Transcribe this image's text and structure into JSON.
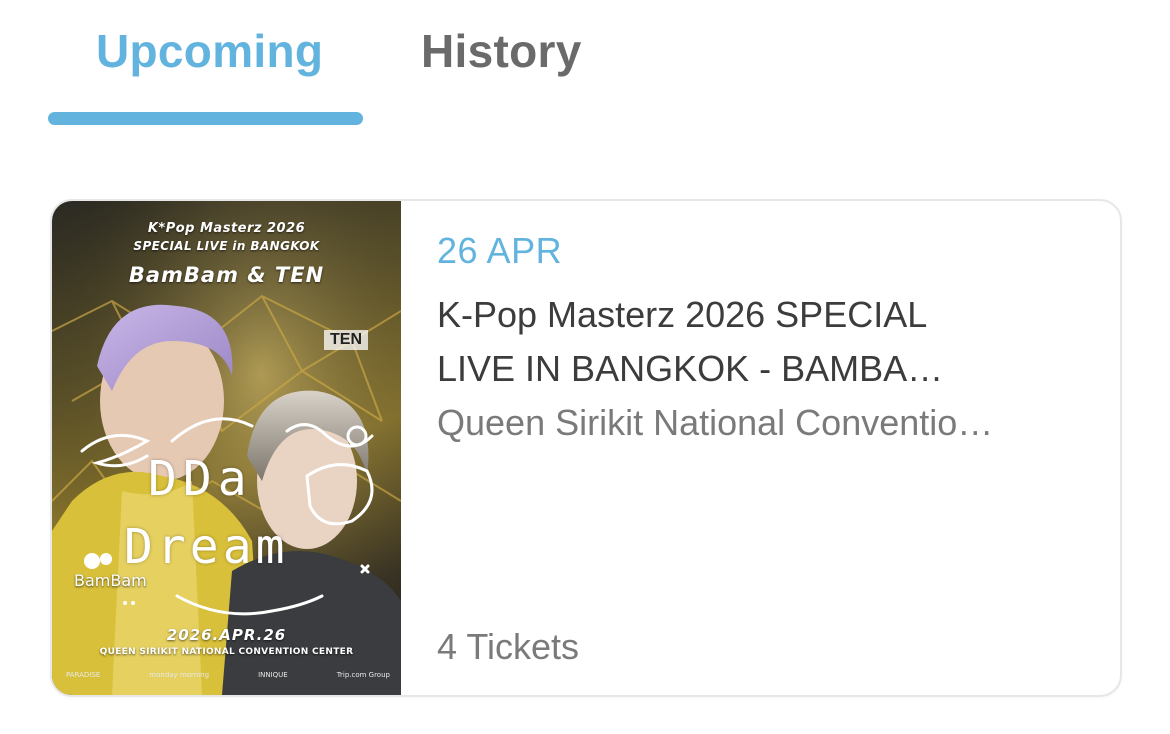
{
  "tabs": [
    {
      "label": "Upcoming",
      "active": true
    },
    {
      "label": "History",
      "active": false
    }
  ],
  "colors": {
    "accent": "#62b4df",
    "title_text": "#3c3c3c",
    "secondary_text": "#7a7a7a",
    "card_border": "#e7e7e7"
  },
  "events": [
    {
      "date": "26 APR",
      "title_line1": "K-Pop Masterz 2026 SPECIAL",
      "title_line2": "LIVE IN BANGKOK - BAMBA…",
      "venue": "Queen Sirikit National Conventio…",
      "tickets": "4 Tickets",
      "poster": {
        "title1": "K*Pop Masterz 2026",
        "title2": "SPECIAL LIVE in BANGKOK",
        "artists": "BamBam & TEN",
        "ten_label": "TEN",
        "bambam_label": "BamBam",
        "doodle_line1": "DDa",
        "doodle_line2": "Dream",
        "date": "2026.APR.26",
        "venue": "QUEEN SIRIKIT NATIONAL CONVENTION CENTER",
        "sponsors": [
          "PARADISE",
          "monday morning",
          "INNIQUE",
          "Trip.com Group"
        ]
      }
    }
  ]
}
